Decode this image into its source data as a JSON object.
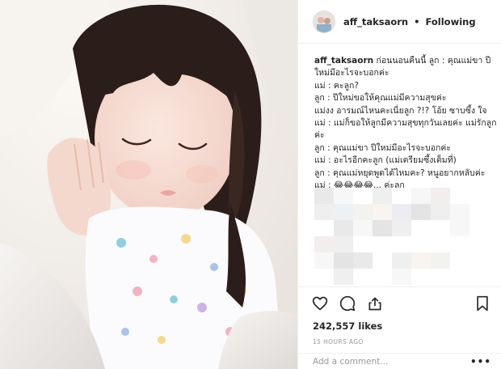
{
  "post": {
    "username": "aff_taksaorn",
    "separator": "•",
    "follow_status": "Following",
    "caption_user": "aff_taksaorn",
    "caption_lines": [
      "ก่อนนอนคืนนี้ ลูก : คุณแม่ขา ปี",
      "ใหม่มีอะไรจะบอกค่ะ",
      "แม่ : คะลูก?",
      "ลูก : ปีใหม่ขอให้คุณแม่มีความสุขค่ะ",
      "แม่งง อารมณ์ไหนคะเนี่ยลูก ?!? โอ้ย ซาบซึ้ง ใจ",
      "แม่ : แม่ก็ขอให้ลูกมีความสุขทุกวันเลยค่ะ แม่รักลูก",
      "ค่ะ",
      "ลูก : คุณแม่ขา ปีใหม่มีอะไรจะบอกค่ะ",
      "แม่ : อะไรอีกคะลูก (แม่เตรียมซึ้งเต็มที่)",
      "ลูก : คุณแม่หยุดพูดได้ไหมคะ? หนูอยากหลับค่ะ",
      "แม่ : 😂😂😂😂... ค่ะลูก"
    ],
    "likes": "242,557 likes",
    "timestamp": "15 HOURS AGO",
    "comment_placeholder": "Add a comment...",
    "more_label": "•••"
  },
  "icons": {
    "like": "heart-icon",
    "comment": "comment-icon",
    "share": "share-icon",
    "save": "bookmark-icon",
    "more": "more-options-icon"
  },
  "colors": {
    "text": "#262626",
    "muted": "#999999",
    "border": "#efefef"
  }
}
